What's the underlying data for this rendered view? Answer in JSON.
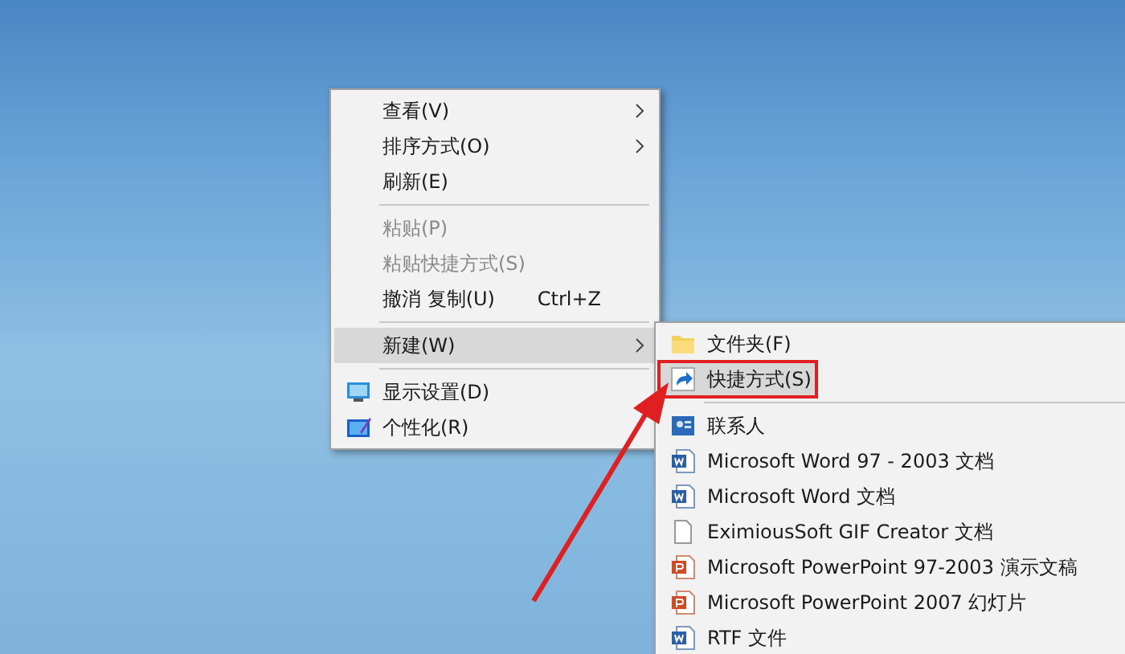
{
  "context_menu": {
    "items": [
      {
        "kind": "item",
        "label": "查看(V)",
        "submenu": true,
        "disabled": false,
        "selected": false
      },
      {
        "kind": "item",
        "label": "排序方式(O)",
        "submenu": true,
        "disabled": false,
        "selected": false
      },
      {
        "kind": "item",
        "label": "刷新(E)",
        "submenu": false,
        "disabled": false,
        "selected": false
      },
      {
        "kind": "separator"
      },
      {
        "kind": "item",
        "label": "粘贴(P)",
        "submenu": false,
        "disabled": true,
        "selected": false
      },
      {
        "kind": "item",
        "label": "粘贴快捷方式(S)",
        "submenu": false,
        "disabled": true,
        "selected": false
      },
      {
        "kind": "item",
        "label": "撤消 复制(U)",
        "shortcut": "Ctrl+Z",
        "submenu": false,
        "disabled": false,
        "selected": false
      },
      {
        "kind": "separator"
      },
      {
        "kind": "item",
        "label": "新建(W)",
        "submenu": true,
        "disabled": false,
        "selected": true
      },
      {
        "kind": "separator"
      },
      {
        "kind": "item",
        "label": "显示设置(D)",
        "submenu": false,
        "disabled": false,
        "selected": false
      },
      {
        "kind": "item",
        "label": "个性化(R)",
        "submenu": false,
        "disabled": false,
        "selected": false
      }
    ]
  },
  "new_submenu": {
    "items": [
      {
        "kind": "item",
        "label": "文件夹(F)",
        "selected": false,
        "highlighted": false
      },
      {
        "kind": "item",
        "label": "快捷方式(S)",
        "selected": true,
        "highlighted": true
      },
      {
        "kind": "separator"
      },
      {
        "kind": "item",
        "label": "联系人",
        "selected": false,
        "highlighted": false
      },
      {
        "kind": "item",
        "label": "Microsoft Word 97 - 2003 文档",
        "selected": false,
        "highlighted": false
      },
      {
        "kind": "item",
        "label": "Microsoft Word 文档",
        "selected": false,
        "highlighted": false
      },
      {
        "kind": "item",
        "label": "EximiousSoft GIF Creator 文档",
        "selected": false,
        "highlighted": false
      },
      {
        "kind": "item",
        "label": "Microsoft PowerPoint 97-2003 演示文稿",
        "selected": false,
        "highlighted": false
      },
      {
        "kind": "item",
        "label": "Microsoft PowerPoint 2007 幻灯片",
        "selected": false,
        "highlighted": false
      },
      {
        "kind": "item",
        "label": "RTF 文件",
        "selected": false,
        "highlighted": false
      }
    ]
  }
}
